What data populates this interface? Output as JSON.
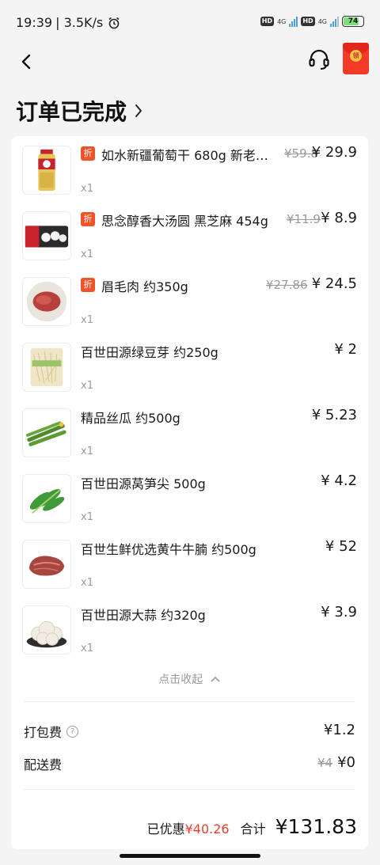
{
  "status_bar": {
    "time": "19:39",
    "net_speed": "| 3.5K/s",
    "hd1": "HD",
    "net1": "4G",
    "hd2": "HD",
    "net2": "4G",
    "battery": "74"
  },
  "header": {
    "order_status": "订单已完成",
    "redpacket_label": "领"
  },
  "items": [
    {
      "name": "如水新疆葡萄干 680g 新老…",
      "orig_price": "¥59.8",
      "price": "¥ 29.9",
      "qty": "x1",
      "discount": "折"
    },
    {
      "name": "思念醇香大汤圆 黑芝麻 454g",
      "orig_price": "¥11.9",
      "price": "¥ 8.9",
      "qty": "x1",
      "discount": "折"
    },
    {
      "name": "眉毛肉 约350g",
      "orig_price": "¥27.86",
      "price": "¥ 24.5",
      "qty": "x1",
      "discount": "折"
    },
    {
      "name": "百世田源绿豆芽 约250g",
      "orig_price": "",
      "price": "¥ 2",
      "qty": "x1",
      "discount": ""
    },
    {
      "name": "精品丝瓜 约500g",
      "orig_price": "",
      "price": "¥ 5.23",
      "qty": "x1",
      "discount": ""
    },
    {
      "name": "百世田源莴笋尖  500g",
      "orig_price": "",
      "price": "¥ 4.2",
      "qty": "x1",
      "discount": ""
    },
    {
      "name": "百世生鲜优选黄牛牛腩 约500g",
      "orig_price": "",
      "price": "¥ 52",
      "qty": "x1",
      "discount": ""
    },
    {
      "name": "百世田源大蒜 约320g",
      "orig_price": "",
      "price": "¥ 3.9",
      "qty": "x1",
      "discount": ""
    }
  ],
  "collapse_label": "点击收起",
  "fees": {
    "packing_label": "打包费",
    "packing_value": "¥1.2",
    "delivery_label": "配送费",
    "delivery_orig": "¥4",
    "delivery_value": "¥0"
  },
  "summary": {
    "saved_label": "已优惠",
    "saved_value": "¥40.26",
    "total_label": "合计",
    "total_value": "¥131.83"
  },
  "colors": {
    "accent_red": "#e8412c",
    "discount_badge": "#f0522a"
  }
}
